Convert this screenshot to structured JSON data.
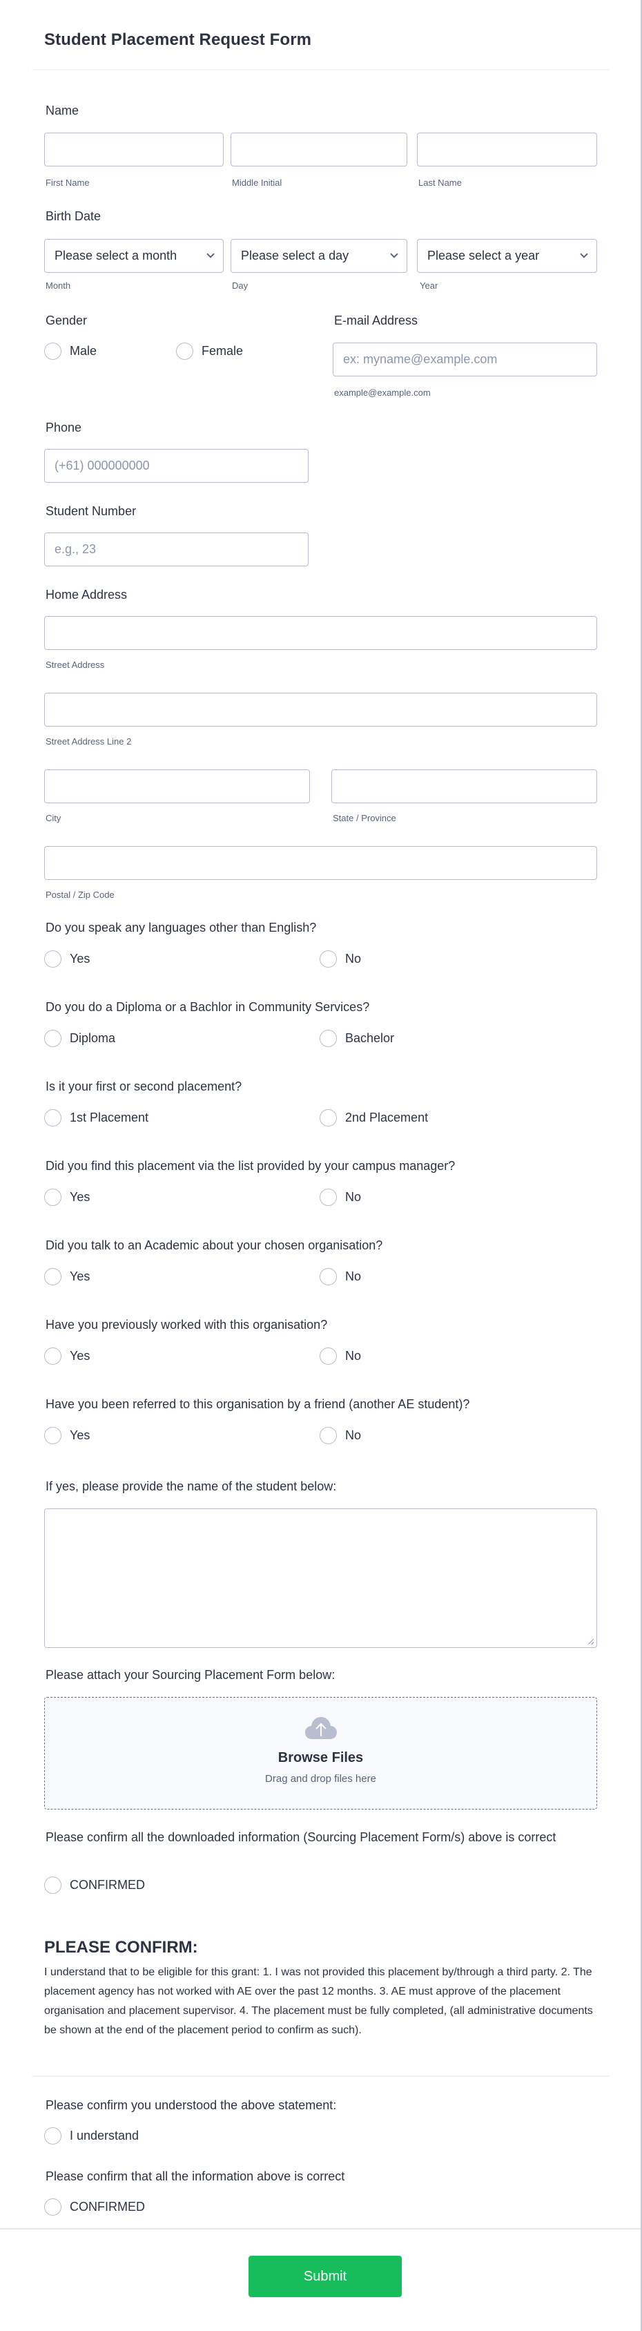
{
  "form": {
    "title": "Student Placement Request Form"
  },
  "name": {
    "label": "Name",
    "first_sublabel": "First Name",
    "middle_sublabel": "Middle Initial",
    "last_sublabel": "Last Name",
    "first_value": "",
    "middle_value": "",
    "last_value": ""
  },
  "birth_date": {
    "label": "Birth Date",
    "month_selected": "Please select a month",
    "day_selected": "Please select a day",
    "year_selected": "Please select a year",
    "month_sublabel": "Month",
    "day_sublabel": "Day",
    "year_sublabel": "Year"
  },
  "gender": {
    "label": "Gender",
    "options": [
      "Male",
      "Female"
    ]
  },
  "email": {
    "label": "E-mail Address",
    "placeholder": "ex: myname@example.com",
    "sublabel": "example@example.com"
  },
  "phone": {
    "label": "Phone",
    "placeholder": "(+61) 000000000"
  },
  "student_number": {
    "label": "Student Number",
    "placeholder": "e.g., 23"
  },
  "address": {
    "label": "Home Address",
    "street_sublabel": "Street Address",
    "street2_sublabel": "Street Address Line 2",
    "city_sublabel": "City",
    "state_sublabel": "State / Province",
    "postal_sublabel": "Postal / Zip Code"
  },
  "questions": [
    {
      "label": "Do you speak any languages other than English?",
      "options": [
        "Yes",
        "No"
      ]
    },
    {
      "label": "Do you do a Diploma or a Bachlor in Community Services?",
      "options": [
        "Diploma",
        "Bachelor"
      ]
    },
    {
      "label": "Is it your first or second placement?",
      "options": [
        "1st Placement",
        "2nd Placement"
      ]
    },
    {
      "label": "Did you find this placement via the list provided by your campus manager?",
      "options": [
        "Yes",
        "No"
      ]
    },
    {
      "label": "Did you talk to an Academic about your chosen organisation?",
      "options": [
        "Yes",
        "No"
      ]
    },
    {
      "label": "Have you previously worked with this organisation?",
      "options": [
        "Yes",
        "No"
      ]
    },
    {
      "label": "Have you been referred to this organisation by a friend (another AE student)?",
      "options": [
        "Yes",
        "No"
      ]
    }
  ],
  "referral_name": {
    "label": "If yes, please provide the name of the student below:",
    "value": ""
  },
  "upload": {
    "label": "Please attach your Sourcing Placement Form below:",
    "title": "Browse Files",
    "subtitle": "Drag and drop files here",
    "icon": "cloud-upload-icon"
  },
  "confirm_downloaded": {
    "label": "Please confirm all the downloaded information (Sourcing Placement Form/s) above is correct",
    "option": "CONFIRMED"
  },
  "please_confirm": {
    "heading": "PLEASE CONFIRM:",
    "text": "I understand that to be eligible for this grant: 1. I was not provided this placement by/through a third party. 2. The placement agency has not worked with AE over the past 12 months. 3. AE must approve of the placement organisation and placement supervisor. 4. The placement must be fully completed, (all administrative documents be shown at the end of the placement period to confirm as such)."
  },
  "understood": {
    "label": "Please confirm you understood the above statement:",
    "option": "I understand"
  },
  "confirm_all": {
    "label": "Please confirm that all the information above is correct",
    "option": "CONFIRMED"
  },
  "submit": {
    "label": "Submit",
    "color": "#18bd5b"
  }
}
